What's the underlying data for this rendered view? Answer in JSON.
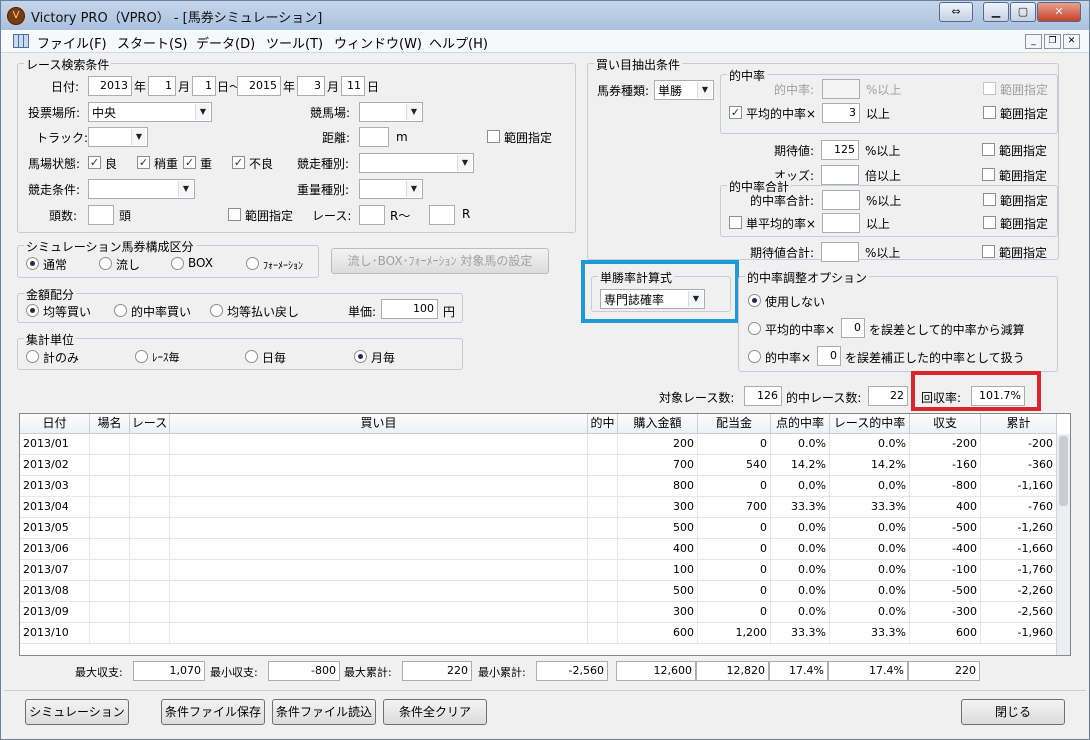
{
  "window": {
    "title": "Victory PRO（VPRO） - [馬券シミュレーション]"
  },
  "menu": [
    "ファイル(F)",
    "スタート(S)",
    "データ(D)",
    "ツール(T)",
    "ウィンドウ(W)",
    "ヘルプ(H)"
  ],
  "race": {
    "group_label": "レース検索条件",
    "date_label": "日付:",
    "from_year": "2013",
    "year_unit": "年",
    "from_month": "1",
    "month_unit": "月",
    "from_day": "1",
    "day_tilde": "日〜",
    "to_year": "2015",
    "to_month": "3",
    "to_day": "11",
    "day_unit": "日",
    "venue_label": "投票場所:",
    "venue_value": "中央",
    "course_label": "競馬場:",
    "track_label": "トラック:",
    "distance_label": "距離:",
    "distance_unit": "m",
    "range_label": "範囲指定",
    "condition_label": "馬場状態:",
    "cond_good": "良",
    "cond_slightly": "稍重",
    "cond_heavy": "重",
    "cond_bad": "不良",
    "race_type_label": "競走種別:",
    "race_cond_label": "競走条件:",
    "weight_label": "重量種別:",
    "heads_label": "頭数:",
    "heads_unit": "頭",
    "heads_range": "範囲指定",
    "race_no_label": "レース:",
    "race_r_tilde": "R〜",
    "race_r": "R"
  },
  "sim": {
    "group_label": "シミュレーション馬券構成区分",
    "normal": "通常",
    "nagashi": "流し",
    "box": "BOX",
    "formation": "ﾌｫｰﾒｰｼｮﾝ",
    "setting_button": "流し･BOX･ﾌｫｰﾒｰｼｮﾝ 対象馬の設定"
  },
  "money": {
    "group_label": "金額配分",
    "equal": "均等買い",
    "hit_buy": "的中率買い",
    "equal_return": "均等払い戻し",
    "unit_label": "単価:",
    "unit_value": "100",
    "unit_suffix": "円"
  },
  "agg": {
    "group_label": "集計単位",
    "total": "計のみ",
    "per_race": "ﾚｰｽ毎",
    "daily": "日毎",
    "monthly": "月毎"
  },
  "buy": {
    "group_label": "買い目抽出条件",
    "ticket_label": "馬券種類:",
    "ticket_value": "単勝",
    "hit_group": "的中率",
    "hit_rate_label": "的中率:",
    "hit_rate_unit": "%以上",
    "range": "範囲指定",
    "avg_hit_label": "平均的中率×",
    "avg_hit_value": "3",
    "avg_hit_unit": "以上",
    "ev_label": "期待値:",
    "ev_value": "125",
    "ev_unit": "%以上",
    "odds_label": "オッズ:",
    "odds_unit": "倍以上",
    "total_group": "的中率合計",
    "total_label": "的中率合計:",
    "total_unit": "%以上",
    "single_avg_label": "単平均的率×",
    "single_avg_unit": "以上",
    "ev_total_label": "期待値合計:",
    "ev_total_unit": "%以上"
  },
  "formula": {
    "group_label": "単勝率計算式",
    "value": "専門誌確率"
  },
  "adjust": {
    "group_label": "的中率調整オプション",
    "none": "使用しない",
    "opt2_prefix": "平均的中率×",
    "opt2_value": "0",
    "opt2_suffix": "を誤差として的中率から減算",
    "opt3_prefix": "的中率×",
    "opt3_value": "0",
    "opt3_suffix": "を誤差補正した的中率として扱う"
  },
  "summary": {
    "target_label": "対象レース数:",
    "target_value": "126",
    "hit_label": "的中レース数:",
    "hit_value": "22",
    "return_label": "回収率:",
    "return_value": "101.7%"
  },
  "table": {
    "headers": [
      "日付",
      "場名",
      "レース",
      "買い目",
      "的中",
      "購入金額",
      "配当金",
      "点的中率",
      "レース的中率",
      "収支",
      "累計"
    ],
    "rows": [
      [
        "2013/01",
        "",
        "",
        "",
        "",
        "200",
        "0",
        "0.0%",
        "0.0%",
        "-200",
        "-200"
      ],
      [
        "2013/02",
        "",
        "",
        "",
        "",
        "700",
        "540",
        "14.2%",
        "14.2%",
        "-160",
        "-360"
      ],
      [
        "2013/03",
        "",
        "",
        "",
        "",
        "800",
        "0",
        "0.0%",
        "0.0%",
        "-800",
        "-1,160"
      ],
      [
        "2013/04",
        "",
        "",
        "",
        "",
        "300",
        "700",
        "33.3%",
        "33.3%",
        "400",
        "-760"
      ],
      [
        "2013/05",
        "",
        "",
        "",
        "",
        "500",
        "0",
        "0.0%",
        "0.0%",
        "-500",
        "-1,260"
      ],
      [
        "2013/06",
        "",
        "",
        "",
        "",
        "400",
        "0",
        "0.0%",
        "0.0%",
        "-400",
        "-1,660"
      ],
      [
        "2013/07",
        "",
        "",
        "",
        "",
        "100",
        "0",
        "0.0%",
        "0.0%",
        "-100",
        "-1,760"
      ],
      [
        "2013/08",
        "",
        "",
        "",
        "",
        "500",
        "0",
        "0.0%",
        "0.0%",
        "-500",
        "-2,260"
      ],
      [
        "2013/09",
        "",
        "",
        "",
        "",
        "300",
        "0",
        "0.0%",
        "0.0%",
        "-300",
        "-2,560"
      ],
      [
        "2013/10",
        "",
        "",
        "",
        "",
        "600",
        "1,200",
        "33.3%",
        "33.3%",
        "600",
        "-1,960"
      ]
    ]
  },
  "footer": {
    "max_bal_label": "最大収支:",
    "max_bal": "1,070",
    "min_bal_label": "最小収支:",
    "min_bal": "-800",
    "max_cum_label": "最大累計:",
    "max_cum": "220",
    "min_cum_label": "最小累計:",
    "min_cum": "-2,560",
    "buy_total": "12,600",
    "payout_total": "12,820",
    "point_rate": "17.4%",
    "race_rate": "17.4%",
    "balance_total": "220"
  },
  "buttons": {
    "simulate": "シミュレーション",
    "save": "条件ファイル保存",
    "load": "条件ファイル読込",
    "clear": "条件全クリア",
    "close": "閉じる"
  },
  "highlight_colors": {
    "formula_box": "#1e9bd7",
    "return_box": "#d9262c"
  }
}
